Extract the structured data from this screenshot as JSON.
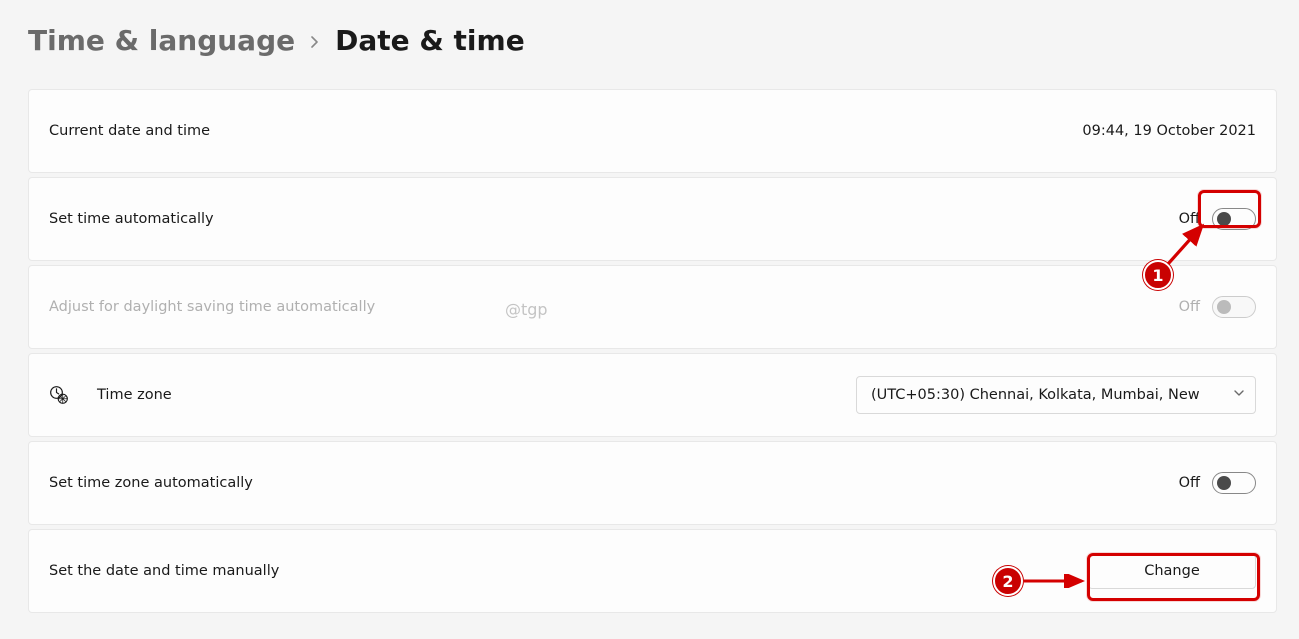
{
  "breadcrumb": {
    "parent": "Time & language",
    "current": "Date & time"
  },
  "rows": {
    "current": {
      "label": "Current date and time",
      "value": "09:44, 19 October 2021"
    },
    "auto_time": {
      "label": "Set time automatically",
      "state": "Off"
    },
    "dst": {
      "label": "Adjust for daylight saving time automatically",
      "state": "Off"
    },
    "timezone": {
      "label": "Time zone",
      "selected": "(UTC+05:30) Chennai, Kolkata, Mumbai, New"
    },
    "auto_tz": {
      "label": "Set time zone automatically",
      "state": "Off"
    },
    "manual": {
      "label": "Set the date and time manually",
      "button": "Change"
    }
  },
  "watermark": "@tgp",
  "annotations": {
    "badge1": "1",
    "badge2": "2"
  }
}
